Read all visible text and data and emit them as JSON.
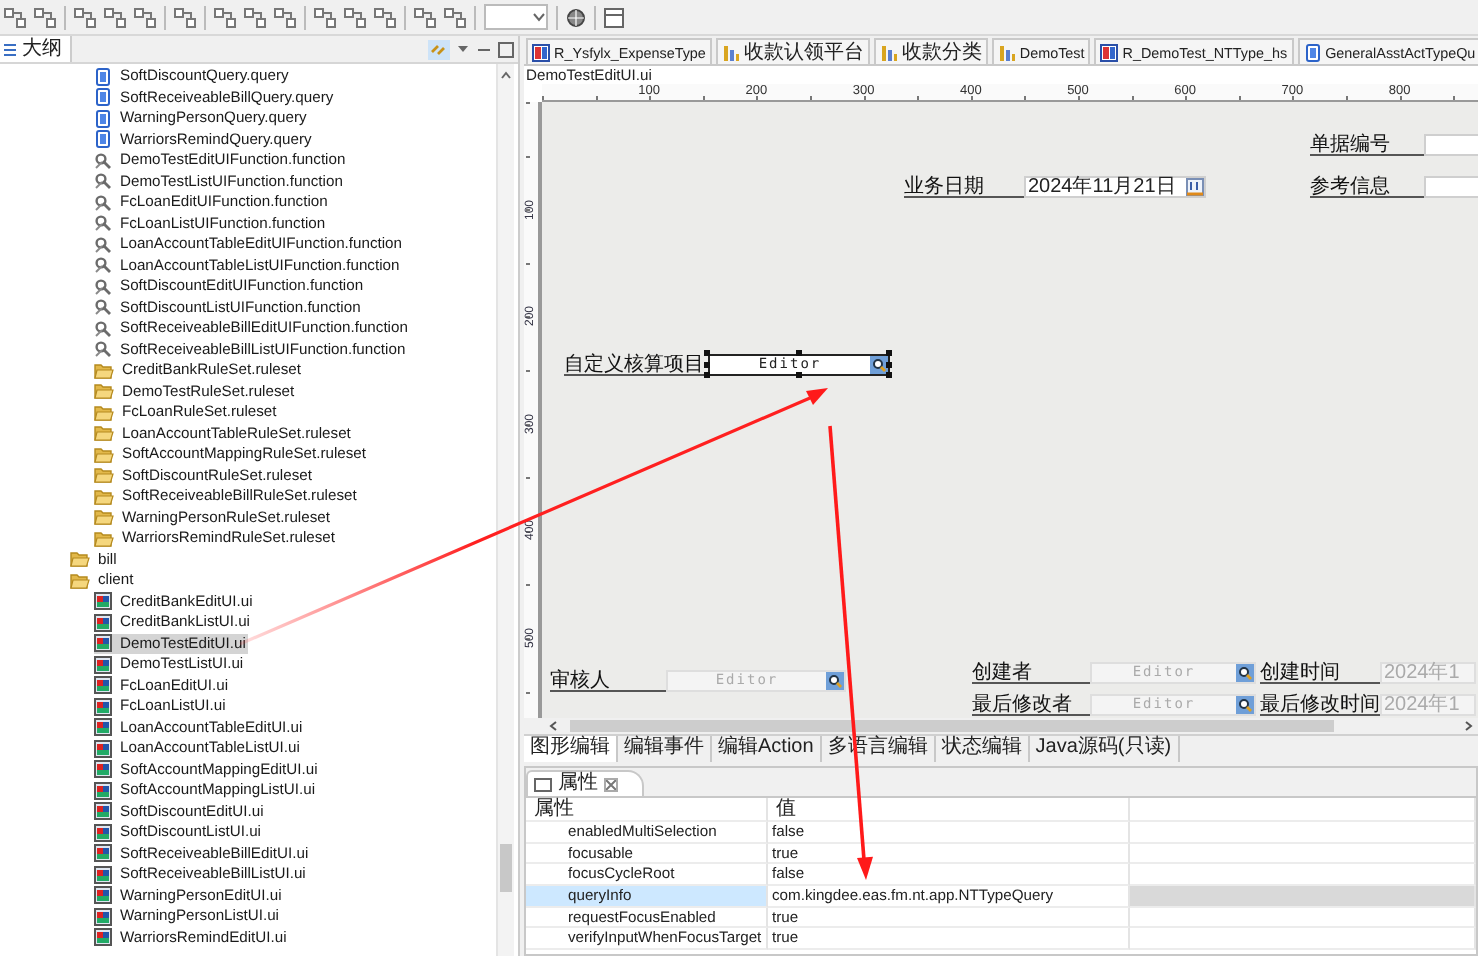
{
  "outline": {
    "title": "大纲",
    "tree": [
      {
        "children": [
          {
            "kind": "query",
            "label": "SoftDiscountQuery.query",
            "selected": false
          },
          {
            "kind": "query",
            "label": "SoftReceiveableBillQuery.query",
            "selected": false
          },
          {
            "kind": "query",
            "label": "WarningPersonQuery.query",
            "selected": false
          },
          {
            "kind": "query",
            "label": "WarriorsRemindQuery.query",
            "selected": false
          },
          {
            "kind": "function",
            "label": "DemoTestEditUIFunction.function",
            "selected": false
          },
          {
            "kind": "function",
            "label": "DemoTestListUIFunction.function",
            "selected": false
          },
          {
            "kind": "function",
            "label": "FcLoanEditUIFunction.function",
            "selected": false
          },
          {
            "kind": "function",
            "label": "FcLoanListUIFunction.function",
            "selected": false
          },
          {
            "kind": "function",
            "label": "LoanAccountTableEditUIFunction.function",
            "selected": false
          },
          {
            "kind": "function",
            "label": "LoanAccountTableListUIFunction.function",
            "selected": false
          },
          {
            "kind": "function",
            "label": "SoftDiscountEditUIFunction.function",
            "selected": false
          },
          {
            "kind": "function",
            "label": "SoftDiscountListUIFunction.function",
            "selected": false
          },
          {
            "kind": "function",
            "label": "SoftReceiveableBillEditUIFunction.function",
            "selected": false
          },
          {
            "kind": "function",
            "label": "SoftReceiveableBillListUIFunction.function",
            "selected": false
          },
          {
            "kind": "ruleset",
            "label": "CreditBankRuleSet.ruleset",
            "selected": false
          },
          {
            "kind": "ruleset",
            "label": "DemoTestRuleSet.ruleset",
            "selected": false
          },
          {
            "kind": "ruleset",
            "label": "FcLoanRuleSet.ruleset",
            "selected": false
          },
          {
            "kind": "ruleset",
            "label": "LoanAccountTableRuleSet.ruleset",
            "selected": false
          },
          {
            "kind": "ruleset",
            "label": "SoftAccountMappingRuleSet.ruleset",
            "selected": false
          },
          {
            "kind": "ruleset",
            "label": "SoftDiscountRuleSet.ruleset",
            "selected": false
          },
          {
            "kind": "ruleset",
            "label": "SoftReceiveableBillRuleSet.ruleset",
            "selected": false
          },
          {
            "kind": "ruleset",
            "label": "WarningPersonRuleSet.ruleset",
            "selected": false
          },
          {
            "kind": "ruleset",
            "label": "WarriorsRemindRuleSet.ruleset",
            "selected": false
          }
        ]
      },
      {
        "kind": "folder",
        "label": "bill",
        "selected": false
      },
      {
        "kind": "folder",
        "label": "client",
        "selected": false,
        "children": [
          {
            "kind": "ui",
            "label": "CreditBankEditUI.ui",
            "selected": false
          },
          {
            "kind": "ui",
            "label": "CreditBankListUI.ui",
            "selected": false
          },
          {
            "kind": "ui",
            "label": "DemoTestEditUI.ui",
            "selected": true
          },
          {
            "kind": "ui",
            "label": "DemoTestListUI.ui",
            "selected": false
          },
          {
            "kind": "ui",
            "label": "FcLoanEditUI.ui",
            "selected": false
          },
          {
            "kind": "ui",
            "label": "FcLoanListUI.ui",
            "selected": false
          },
          {
            "kind": "ui",
            "label": "LoanAccountTableEditUI.ui",
            "selected": false
          },
          {
            "kind": "ui",
            "label": "LoanAccountTableListUI.ui",
            "selected": false
          },
          {
            "kind": "ui",
            "label": "SoftAccountMappingEditUI.ui",
            "selected": false
          },
          {
            "kind": "ui",
            "label": "SoftAccountMappingListUI.ui",
            "selected": false
          },
          {
            "kind": "ui",
            "label": "SoftDiscountEditUI.ui",
            "selected": false
          },
          {
            "kind": "ui",
            "label": "SoftDiscountListUI.ui",
            "selected": false
          },
          {
            "kind": "ui",
            "label": "SoftReceiveableBillEditUI.ui",
            "selected": false
          },
          {
            "kind": "ui",
            "label": "SoftReceiveableBillListUI.ui",
            "selected": false
          },
          {
            "kind": "ui",
            "label": "WarningPersonEditUI.ui",
            "selected": false
          },
          {
            "kind": "ui",
            "label": "WarningPersonListUI.ui",
            "selected": false
          },
          {
            "kind": "ui",
            "label": "WarriorsRemindEditUI.ui",
            "selected": false
          }
        ]
      }
    ]
  },
  "editor": {
    "tabs": [
      {
        "kind": "report",
        "label": "R_Ysfylx_ExpenseType",
        "selected": false
      },
      {
        "kind": "chart",
        "label": "收款认领平台",
        "selected": false
      },
      {
        "kind": "chart",
        "label": "收款分类",
        "selected": false
      },
      {
        "kind": "chart",
        "label": "DemoTest",
        "selected": false
      },
      {
        "kind": "report",
        "label": "R_DemoTest_NTType_hs",
        "selected": false
      },
      {
        "kind": "query",
        "label": "GeneralAsstActTypeQu",
        "selected": false
      }
    ],
    "file_name": "DemoTestEditUI.ui",
    "ruler": {
      "x_labels": [
        "100",
        "200",
        "300",
        "400",
        "500",
        "600",
        "700",
        "800"
      ],
      "y_labels": [
        "100",
        "200",
        "300",
        "400",
        "500"
      ]
    },
    "form_fields": [
      {
        "label": "单据编号",
        "kind": "text",
        "disabled": false,
        "selected": false
      },
      {
        "label": "业务日期",
        "kind": "date",
        "value": "2024年11月21日",
        "disabled": false,
        "selected": false
      },
      {
        "label": "参考信息",
        "kind": "text",
        "disabled": false,
        "selected": false
      },
      {
        "label": "自定义核算项目",
        "kind": "prompt",
        "value": "Editor",
        "disabled": false,
        "selected": true
      },
      {
        "label": "审核人",
        "kind": "prompt",
        "value": "Editor",
        "disabled": true,
        "selected": false
      },
      {
        "label": "创建者",
        "kind": "prompt",
        "value": "Editor",
        "disabled": true,
        "selected": false
      },
      {
        "label": "创建时间",
        "kind": "date",
        "value": "2024年1",
        "disabled": true,
        "selected": false
      },
      {
        "label": "最后修改者",
        "kind": "prompt",
        "value": "Editor",
        "disabled": true,
        "selected": false
      },
      {
        "label": "最后修改时间",
        "kind": "date",
        "value": "2024年1",
        "disabled": true,
        "selected": false
      }
    ],
    "view_tabs": [
      {
        "label": "图形编辑",
        "selected": true
      },
      {
        "label": "编辑事件",
        "selected": false
      },
      {
        "label": "编辑Action",
        "selected": false
      },
      {
        "label": "多语言编辑",
        "selected": false
      },
      {
        "label": "状态编辑",
        "selected": false
      },
      {
        "label": "Java源码(只读)",
        "selected": false
      }
    ]
  },
  "properties": {
    "title": "属性",
    "columns": [
      "属性",
      "值"
    ],
    "rows": [
      {
        "name": "enabledMultiSelection",
        "value": "false",
        "selected": false
      },
      {
        "name": "focusable",
        "value": "true",
        "selected": false
      },
      {
        "name": "focusCycleRoot",
        "value": "false",
        "selected": false
      },
      {
        "name": "queryInfo",
        "value": "com.kingdee.eas.fm.nt.app.NTTypeQuery",
        "selected": true
      },
      {
        "name": "requestFocusEnabled",
        "value": "true",
        "selected": false
      },
      {
        "name": "verifyInputWhenFocusTarget",
        "value": "true",
        "selected": false
      }
    ]
  }
}
